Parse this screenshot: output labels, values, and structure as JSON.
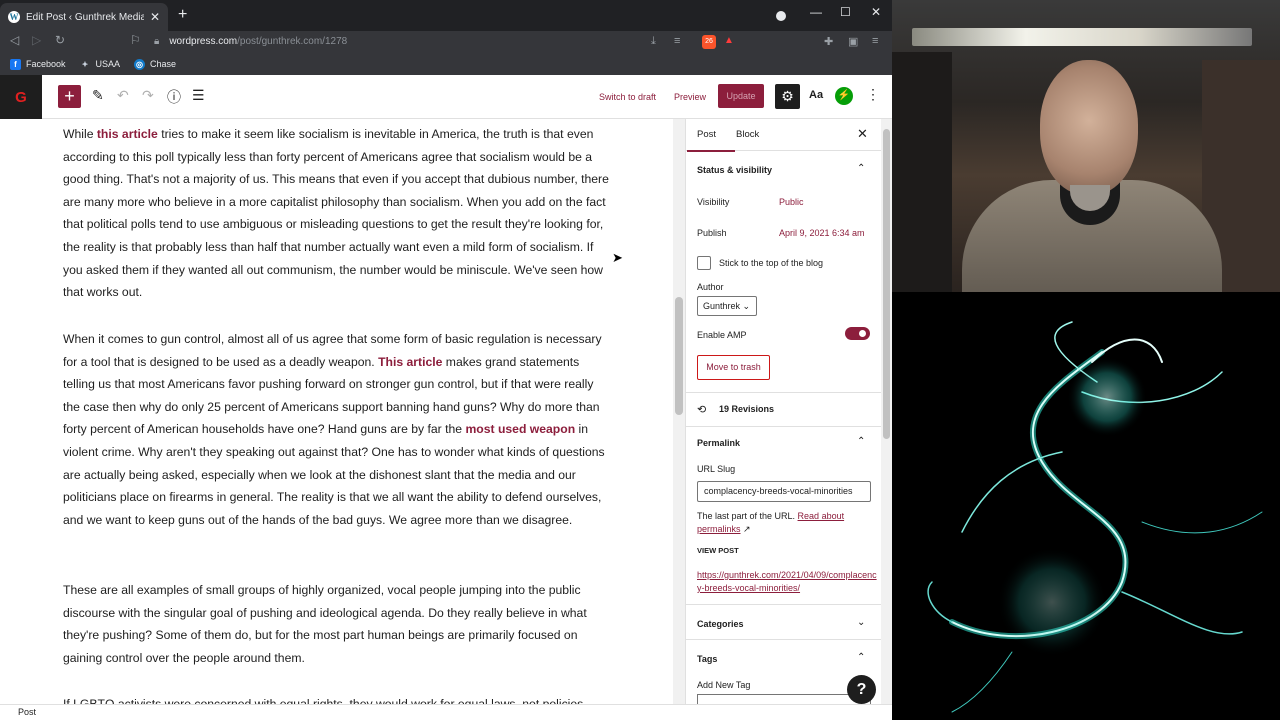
{
  "browser": {
    "tab_title": "Edit Post ‹ Gunthrek Media — W",
    "url_host": "wordpress.com",
    "url_path": "/post/gunthrek.com/1278",
    "bookmarks": [
      "Facebook",
      "USAA",
      "Chase"
    ]
  },
  "header": {
    "switch_to_draft": "Switch to draft",
    "preview": "Preview",
    "update": "Update",
    "styles": "Aa"
  },
  "content": {
    "p1": {
      "pre": "While ",
      "link": "this article",
      "post": " tries to make it seem like socialism is inevitable in America, the truth is that even according to this poll typically less than forty percent of Americans agree that socialism would be a good thing.  That's not a majority of us.  This means that even if you accept that dubious number, there are many more who believe in a more capitalist philosophy than socialism.  When you add on the fact that political polls tend to use ambiguous or misleading questions to get the result they're looking for, the reality is that probably less than half that number actually want even a mild form of socialism.  If you asked them if they wanted all out communism, the number would be miniscule.  We've seen how that works out."
    },
    "p2": {
      "pre": "When it comes to gun control, almost all of us agree that some form of basic regulation is necessary for a tool that is designed to be used as a deadly weapon.  ",
      "link1": "This article",
      "mid": " makes grand statements telling us that most Americans favor pushing forward on stronger gun control, but if that were really the case then why do only 25 percent of Americans support banning hand guns?  Why do more than forty percent of American households have one?  Hand guns are by far the ",
      "link2": "most used weapon",
      "post": " in violent crime.  Why aren't they speaking out against that?  One has to wonder what kinds of questions are actually being asked, especially when we look at the dishonest slant that the media and our politicians place on firearms in general.  The reality is that we all want the ability to defend ourselves, and we want to keep guns out of the hands of the bad guys.  We agree more than we disagree."
    },
    "p3": "These are all examples of small groups of highly organized, vocal people jumping into the public discourse with the singular goal of pushing and ideological agenda.  Do they really believe in what they're pushing?  Some of them do, but for the most part human beings are primarily focused on gaining control over the people around them.",
    "p4_partial": "If LGBTQ activists were concerned with equal rights, they would work for equal laws, not policies"
  },
  "sidebar": {
    "tab_post": "Post",
    "tab_block": "Block",
    "status_heading": "Status & visibility",
    "visibility_label": "Visibility",
    "visibility_value": "Public",
    "publish_label": "Publish",
    "publish_value": "April 9, 2021 6:34 am",
    "sticky_label": "Stick to the top of the blog",
    "author_label": "Author",
    "author_value": "Gunthrek",
    "amp_label": "Enable AMP",
    "amp_enabled": true,
    "trash_label": "Move to trash",
    "revisions_label": "19 Revisions",
    "permalink_heading": "Permalink",
    "url_slug_label": "URL Slug",
    "url_slug_value": "complacency-breeds-vocal-minorities",
    "slug_help_pre": "The last part of the URL. ",
    "slug_help_link": "Read about permalinks",
    "view_post_label": "VIEW POST",
    "view_post_url": "https://gunthrek.com/2021/04/09/complacency-breeds-vocal-minorities/",
    "categories_heading": "Categories",
    "tags_heading": "Tags",
    "add_tag_label": "Add New Tag"
  },
  "footer": {
    "breadcrumb": "Post"
  },
  "colors": {
    "accent": "#8c1e3c",
    "dark": "#1e1e1e",
    "chrome": "#35363a",
    "glow": "#3ff0e0"
  }
}
